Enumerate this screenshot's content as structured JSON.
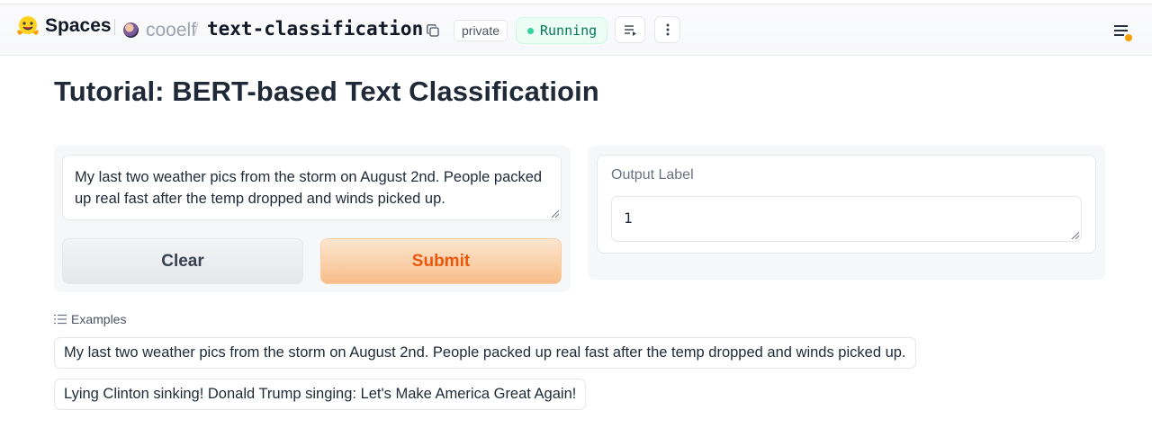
{
  "header": {
    "brand": "Spaces",
    "owner": "cooelf",
    "separator": "/",
    "repo": "text-classification",
    "visibility_badge": "private",
    "status_badge": "Running"
  },
  "page": {
    "title": "Tutorial: BERT-based Text Classificatioin"
  },
  "input": {
    "text": "My last two weather pics from the storm on August 2nd. People packed up real fast after the temp dropped and winds picked up."
  },
  "buttons": {
    "clear": "Clear",
    "submit": "Submit"
  },
  "output": {
    "label": "Output Label",
    "value": "1"
  },
  "examples": {
    "header": "Examples",
    "items": [
      "My last two weather pics from the storm on August 2nd. People packed up real fast after the temp dropped and winds picked up.",
      "Lying Clinton sinking! Donald Trump singing: Let's Make America Great Again!"
    ]
  },
  "colors": {
    "submit_text": "#ea580c",
    "running_text": "#047857",
    "running_dot": "#34d399"
  }
}
